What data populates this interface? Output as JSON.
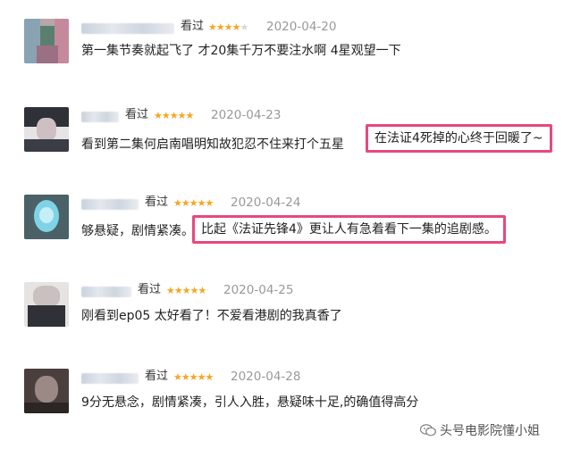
{
  "reviews": [
    {
      "status": "看过",
      "rating": 4,
      "date": "2020-04-20",
      "comment": "第一集节奏就起飞了 才20集千万不要注水啊 4星观望一下",
      "highlight": null
    },
    {
      "status": "看过",
      "rating": 5,
      "date": "2020-04-23",
      "comment": "看到第二集何启南唱明知故犯忍不住来打个五星",
      "highlight": "在法证4死掉的心终于回暖了~"
    },
    {
      "status": "看过",
      "rating": 5,
      "date": "2020-04-24",
      "comment": "够悬疑，剧情紧凑。",
      "highlight": "比起《法证先锋4》更让人有急着看下一集的追剧感。"
    },
    {
      "status": "看过",
      "rating": 5,
      "date": "2020-04-25",
      "comment": "刚看到ep05 太好看了！不爱看港剧的我真香了",
      "highlight": null
    },
    {
      "status": "看过",
      "rating": 5,
      "date": "2020-04-28",
      "comment": "9分无悬念，剧情紧凑，引人入胜，悬疑味十足,的确值得高分",
      "highlight": null
    }
  ],
  "watermark": {
    "text": "头号电影院懂小姐",
    "icon": "wechat-icon"
  },
  "colors": {
    "highlight_border": "#e8487d",
    "star": "#f5a623",
    "date": "#999999"
  }
}
